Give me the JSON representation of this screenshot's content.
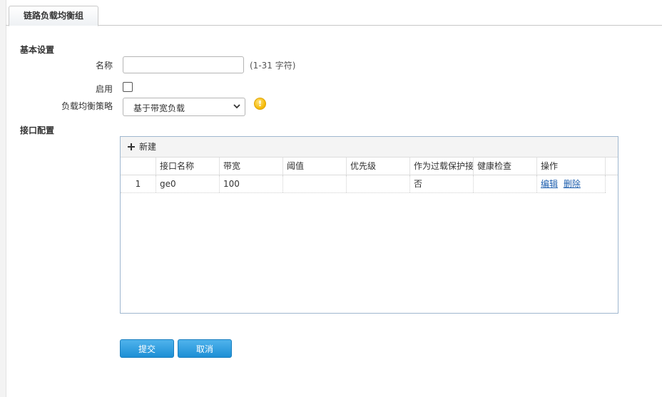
{
  "tab": {
    "label": "链路负载均衡组"
  },
  "basic": {
    "section_title": "基本设置",
    "name_label": "名称",
    "name_value": "",
    "name_hint": "(1-31 字符)",
    "enable_label": "启用",
    "enable_checked": false,
    "strategy_label": "负载均衡策略",
    "strategy_value": "基于带宽负载",
    "warning_glyph": "!"
  },
  "iface": {
    "section_title": "接口配置",
    "new_label": "新建",
    "columns": [
      "",
      "接口名称",
      "带宽",
      "阈值",
      "优先级",
      "作为过载保护接",
      "健康检查",
      "操作"
    ],
    "rows": [
      {
        "index": "1",
        "name": "ge0",
        "bandwidth": "100",
        "threshold": "",
        "priority": "",
        "overload": "否",
        "health": "",
        "edit": "编辑",
        "delete": "删除"
      }
    ]
  },
  "actions": {
    "submit": "提交",
    "cancel": "取消"
  },
  "colors": {
    "accent": "#2a9ae0",
    "link": "#1f5fae",
    "warning": "#f5b800"
  },
  "icons": {
    "new": "plus-icon",
    "strategy": "chevron-down-icon",
    "warning": "warning-icon"
  }
}
